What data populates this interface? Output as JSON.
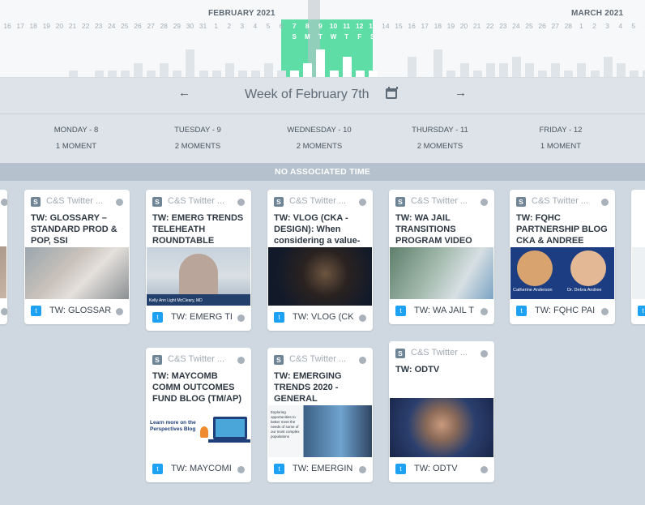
{
  "timeline": {
    "months": [
      {
        "label": "FEBRUARY 2021"
      },
      {
        "label": "MARCH 2021"
      }
    ],
    "days": [
      {
        "d": "16",
        "level": 0
      },
      {
        "d": "17",
        "level": 0
      },
      {
        "d": "18",
        "level": 0
      },
      {
        "d": "19",
        "level": 0
      },
      {
        "d": "20",
        "level": 0
      },
      {
        "d": "21",
        "level": 0
      },
      {
        "d": "22",
        "level": 0
      },
      {
        "d": "23",
        "level": 0
      },
      {
        "d": "24",
        "level": 0
      },
      {
        "d": "25",
        "level": 0
      },
      {
        "d": "26",
        "level": 0
      },
      {
        "d": "27",
        "level": 0
      },
      {
        "d": "28",
        "level": 0
      },
      {
        "d": "29",
        "level": 0
      },
      {
        "d": "30",
        "level": 0
      },
      {
        "d": "31",
        "level": 0
      },
      {
        "d": "1",
        "level": 0
      },
      {
        "d": "2",
        "level": 0
      },
      {
        "d": "3",
        "level": 0
      },
      {
        "d": "4",
        "level": 0
      },
      {
        "d": "5",
        "level": 0
      },
      {
        "d": "6",
        "level": 0
      },
      {
        "d": "7",
        "dow": "S",
        "level": 0
      },
      {
        "d": "8",
        "dow": "M",
        "level": 0
      },
      {
        "d": "9",
        "dow": "T",
        "level": 0
      },
      {
        "d": "10",
        "dow": "W",
        "level": 0
      },
      {
        "d": "11",
        "dow": "T",
        "level": 0
      },
      {
        "d": "12",
        "dow": "F",
        "level": 0
      },
      {
        "d": "13",
        "dow": "S",
        "level": 0
      },
      {
        "d": "14",
        "level": 0
      },
      {
        "d": "15",
        "level": 0
      },
      {
        "d": "16",
        "level": 0
      },
      {
        "d": "17",
        "level": 0
      },
      {
        "d": "18",
        "level": 0
      },
      {
        "d": "19",
        "level": 0
      },
      {
        "d": "20",
        "level": 0
      },
      {
        "d": "21",
        "level": 0
      },
      {
        "d": "22",
        "level": 0
      },
      {
        "d": "23",
        "level": 0
      },
      {
        "d": "24",
        "level": 0
      },
      {
        "d": "25",
        "level": 0
      },
      {
        "d": "26",
        "level": 0
      },
      {
        "d": "27",
        "level": 0
      },
      {
        "d": "28",
        "level": 0
      },
      {
        "d": "1",
        "level": 0
      },
      {
        "d": "2",
        "level": 0
      },
      {
        "d": "3",
        "level": 0
      },
      {
        "d": "4",
        "level": 0
      },
      {
        "d": "5",
        "level": 0
      },
      {
        "d": "6",
        "level": 0
      }
    ],
    "bar_levels": [
      0.0,
      0.0,
      0.0,
      0.0,
      0.0,
      0.0,
      0.0,
      0.0,
      0.0,
      0.0,
      0.0,
      0.0,
      0.0,
      0.0,
      0.0,
      0.0,
      0.0,
      0.0,
      0.0,
      0.0,
      0.0,
      0.0,
      0.0,
      0.0,
      0.0,
      0.0,
      0.0,
      0.0,
      0.0,
      0.0,
      0.0,
      0.0,
      0.0,
      0.0,
      0.0,
      0.0,
      0.0,
      0.0,
      0.0,
      0.0,
      0.0,
      0.0,
      0.0,
      0.0,
      0.0,
      0.0,
      0.0,
      0.0,
      0.0,
      0.0
    ],
    "week_highlight_color": "#5fdda6"
  },
  "week_nav": {
    "prev_icon": "arrow-left-icon",
    "prev_label": "←",
    "title": "Week of February 7th",
    "calendar_icon": "calendar-icon",
    "next_icon": "arrow-right-icon",
    "next_label": "→"
  },
  "day_headers": [
    {
      "name": "MONDAY - 8",
      "count": "1 MOMENT"
    },
    {
      "name": "TUESDAY - 9",
      "count": "2 MOMENTS"
    },
    {
      "name": "WEDNESDAY - 10",
      "count": "2 MOMENTS"
    },
    {
      "name": "THURSDAY - 11",
      "count": "2 MOMENTS"
    },
    {
      "name": "FRIDAY - 12",
      "count": "1 MOMENT"
    }
  ],
  "no_time_label": "NO ASSOCIATED TIME",
  "cards": [
    {
      "badge": "S",
      "account": "C&S Twitter ...",
      "title": "TW: GLOSSARY – STANDARD PROD & POP, SSI",
      "footer": "TW: GLOSSAR",
      "thumb": "th-glossary"
    },
    {
      "badge": "S",
      "account": "C&S Twitter ...",
      "title": "TW: EMERG TRENDS TELEHEATH ROUNDTABLE",
      "footer": "TW: EMERG TI",
      "thumb": "th-emerg"
    },
    {
      "badge": "S",
      "account": "C&S Twitter ...",
      "title": "TW: VLOG (CKA - DESIGN): When considering a value-",
      "footer": "TW: VLOG (CK",
      "thumb": "th-vlog"
    },
    {
      "badge": "S",
      "account": "C&S Twitter ...",
      "title": "TW: WA JAIL TRANSITIONS PROGRAM VIDEO",
      "footer": "TW: WA JAIL T",
      "thumb": "th-jail"
    },
    {
      "badge": "S",
      "account": "C&S Twitter ...",
      "title": "TW: FQHC PARTNERSHIP BLOG CKA & ANDREE",
      "footer": "TW: FQHC PAI",
      "thumb": "th-fqhc"
    },
    {
      "badge": "S",
      "account": "C&S Twitter ...",
      "title": "TW: MAYCOMB COMM OUTCOMES FUND BLOG (TM/AP)",
      "footer": "TW: MAYCOMI",
      "thumb": "th-maycomb"
    },
    {
      "badge": "S",
      "account": "C&S Twitter ...",
      "title": "TW: EMERGING TRENDS 2020 - GENERAL",
      "footer": "TW: EMERGIN",
      "thumb": "th-trends"
    },
    {
      "badge": "S",
      "account": "C&S Twitter ...",
      "title": "TW: ODTV",
      "footer": "TW: ODTV",
      "thumb": "th-odtv"
    }
  ],
  "thumb_text": {
    "emerg_caption": "Kelly Ann Light McCleary, MD",
    "fqhc_left": "Catherine Anderson",
    "fqhc_right": "Dr. Debra Andree",
    "maycomb_caption": "Learn more on the Perspectives Blog",
    "trends_caption": "Exploring opportunities to better meet the needs of some of our most complex populations"
  },
  "colors": {
    "accent_green": "#5fdda6",
    "twitter_blue": "#1da1f2",
    "badge_gray": "#6f8596",
    "band_gray": "#b5c1cc"
  }
}
